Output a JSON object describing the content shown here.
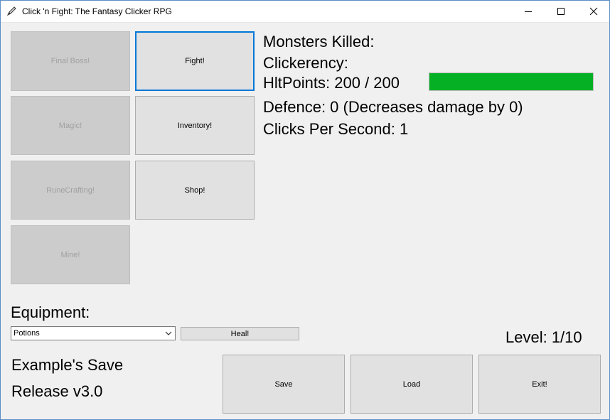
{
  "window": {
    "title": "Click 'n Fight: The Fantasy Clicker RPG"
  },
  "icons": {
    "app": "pen-icon",
    "minimize": "minimize-icon",
    "maximize": "maximize-icon",
    "close": "close-icon",
    "dropdown": "chevron-down-icon"
  },
  "actions": {
    "final_boss": "Final Boss!",
    "fight": "Fight!",
    "magic": "Magic!",
    "inventory": "Inventory!",
    "runecrafting": "RuneCrafting!",
    "shop": "Shop!",
    "mine": "Mine!"
  },
  "stats": {
    "monsters_killed": "Monsters Killed:",
    "clickerency": "Clickerency:",
    "hitpoints": "HltPoints: 200 / 200",
    "hitpoints_fraction": 1.0,
    "defence": "Defence: 0 (Decreases damage by 0)",
    "clicks_per_second": "Clicks Per Second: 1"
  },
  "equipment": {
    "label": "Equipment:",
    "selected": "Potions",
    "heal_label": "Heal!"
  },
  "level": "Level: 1/10",
  "save_name": "Example's Save",
  "version": "Release v3.0",
  "footer": {
    "save": "Save",
    "load": "Load",
    "exit": "Exit!"
  },
  "colors": {
    "hp_bar": "#06b025",
    "focus": "#0078d7",
    "close_hover": "#e81123"
  }
}
